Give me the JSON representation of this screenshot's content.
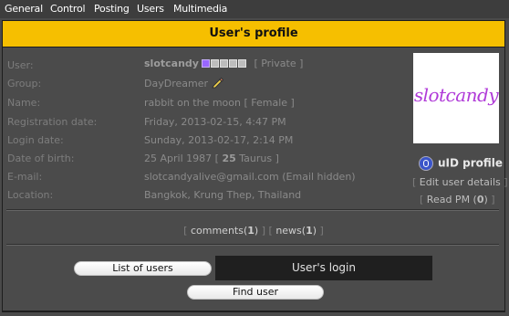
{
  "nav": {
    "items": [
      "General",
      "Control",
      "Posting",
      "Users",
      "Multimedia"
    ]
  },
  "panel": {
    "title": "User's profile"
  },
  "profile": {
    "labels": {
      "user": "User:",
      "group": "Group:",
      "name": "Name:",
      "registration": "Registration date:",
      "login": "Login date:",
      "dob": "Date of birth:",
      "email": "E-mail:",
      "location": "Location:"
    },
    "values": {
      "username": "slotcandy",
      "rating_filled": 1,
      "rating_total": 5,
      "privacy": "[ Private ]",
      "group": "DayDreamer",
      "name": "rabbit on the moon",
      "gender": "[ Female ]",
      "registration": "Friday, 2013-02-15, 4:47 PM",
      "login": "Sunday, 2013-02-17, 2:14 PM",
      "dob_date": "25 April 1987",
      "dob_age": "25",
      "dob_sign": "Taurus",
      "email": "slotcandyalive@gmail.com (Email hidden)",
      "location": "Bangkok, Krung Thep, Thailand"
    },
    "group_icon": "pencil-icon",
    "avatar_text": "slotcandy",
    "uid_label": "uID profile",
    "edit_label": "Edit user details",
    "read_pm_label": "Read PM",
    "read_pm_count": "0"
  },
  "links": {
    "comments_label": "comments",
    "comments_count": "1",
    "news_label": "news",
    "news_count": "1"
  },
  "buttons": {
    "list_users": "List of users",
    "login": "User's login",
    "find_user": "Find user"
  },
  "colors": {
    "title_bar": "#f6bf00",
    "background": "#4b4b4b",
    "accent_purple": "#9966ff"
  }
}
